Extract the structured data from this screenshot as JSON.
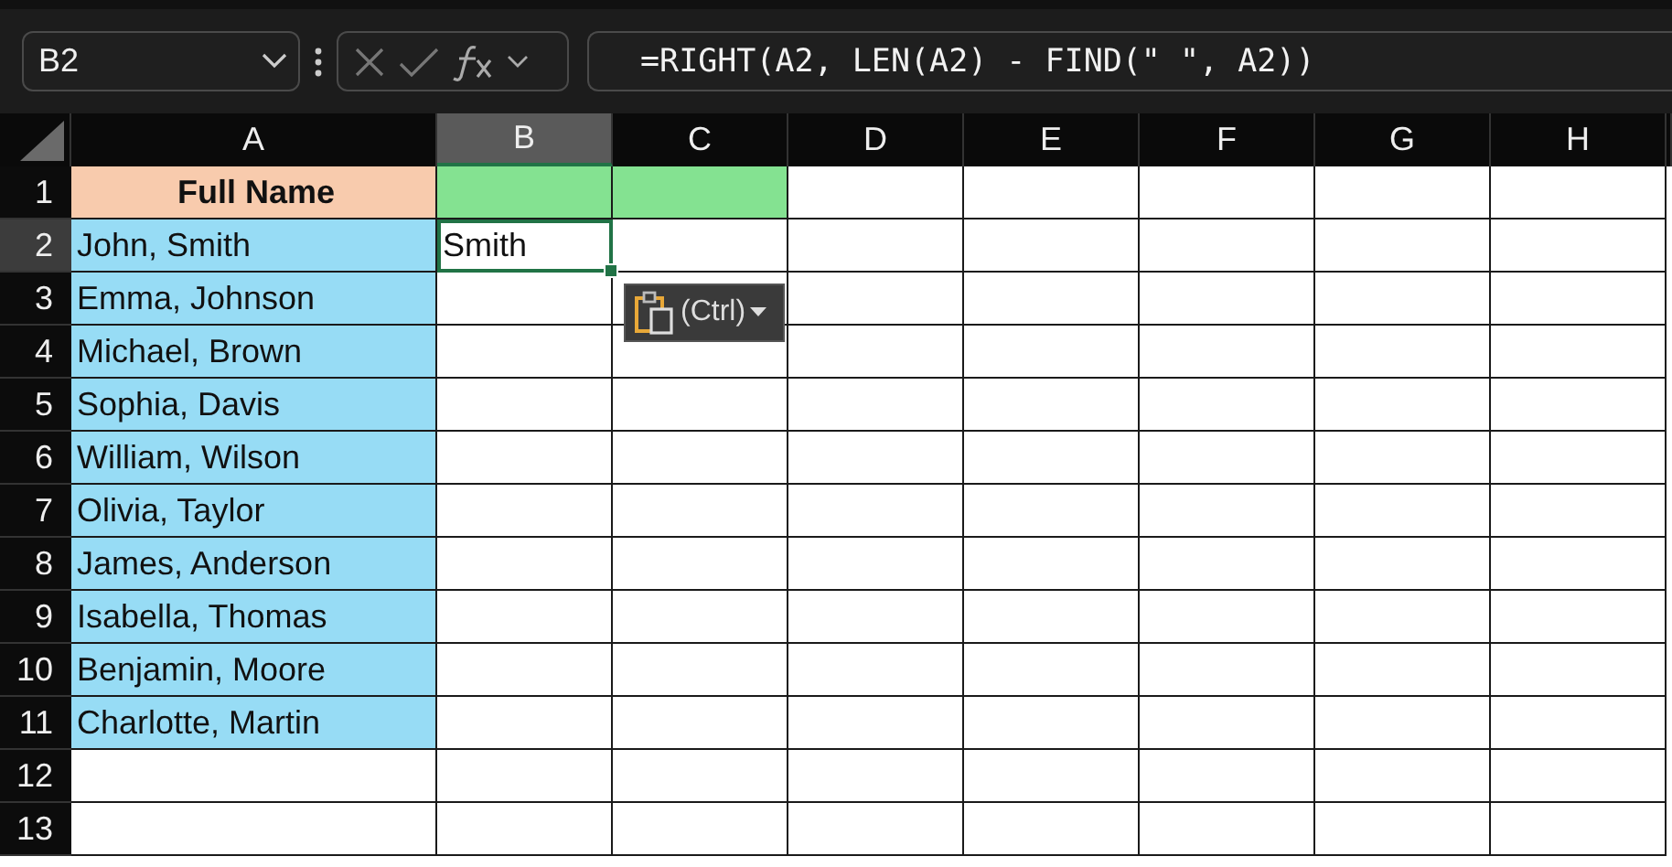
{
  "name_box": {
    "value": "B2"
  },
  "formula_bar": {
    "formula": "=RIGHT(A2, LEN(A2) - FIND(\" \", A2))"
  },
  "columns": [
    {
      "label": "A",
      "selected": false
    },
    {
      "label": "B",
      "selected": true
    },
    {
      "label": "C",
      "selected": false
    },
    {
      "label": "D",
      "selected": false
    },
    {
      "label": "E",
      "selected": false
    },
    {
      "label": "F",
      "selected": false
    },
    {
      "label": "G",
      "selected": false
    },
    {
      "label": "H",
      "selected": false
    }
  ],
  "rows": [
    {
      "number": "1",
      "selected": false,
      "cells": [
        {
          "text": "Full Name",
          "bold": true,
          "color": "#f8cbad"
        },
        {
          "color": "#84e291"
        },
        {
          "color": "#84e291"
        }
      ]
    },
    {
      "number": "2",
      "selected": true,
      "cells": [
        {
          "text": "John, Smith",
          "color": "#97dcf5"
        },
        {
          "text": "Smith",
          "active": true
        }
      ]
    },
    {
      "number": "3",
      "selected": false,
      "cells": [
        {
          "text": "Emma, Johnson",
          "color": "#97dcf5"
        }
      ]
    },
    {
      "number": "4",
      "selected": false,
      "cells": [
        {
          "text": "Michael, Brown",
          "color": "#97dcf5"
        }
      ]
    },
    {
      "number": "5",
      "selected": false,
      "cells": [
        {
          "text": "Sophia, Davis",
          "color": "#97dcf5"
        }
      ]
    },
    {
      "number": "6",
      "selected": false,
      "cells": [
        {
          "text": "William, Wilson",
          "color": "#97dcf5"
        }
      ]
    },
    {
      "number": "7",
      "selected": false,
      "cells": [
        {
          "text": "Olivia, Taylor",
          "color": "#97dcf5"
        }
      ]
    },
    {
      "number": "8",
      "selected": false,
      "cells": [
        {
          "text": "James, Anderson",
          "color": "#97dcf5"
        }
      ]
    },
    {
      "number": "9",
      "selected": false,
      "cells": [
        {
          "text": "Isabella, Thomas",
          "color": "#97dcf5"
        }
      ]
    },
    {
      "number": "10",
      "selected": false,
      "cells": [
        {
          "text": "Benjamin, Moore",
          "color": "#97dcf5"
        }
      ]
    },
    {
      "number": "11",
      "selected": false,
      "cells": [
        {
          "text": "Charlotte, Martin",
          "color": "#97dcf5"
        }
      ]
    },
    {
      "number": "12",
      "selected": false,
      "cells": []
    },
    {
      "number": "13",
      "selected": false,
      "cells": []
    }
  ],
  "paste_options": {
    "label": "(Ctrl)"
  }
}
